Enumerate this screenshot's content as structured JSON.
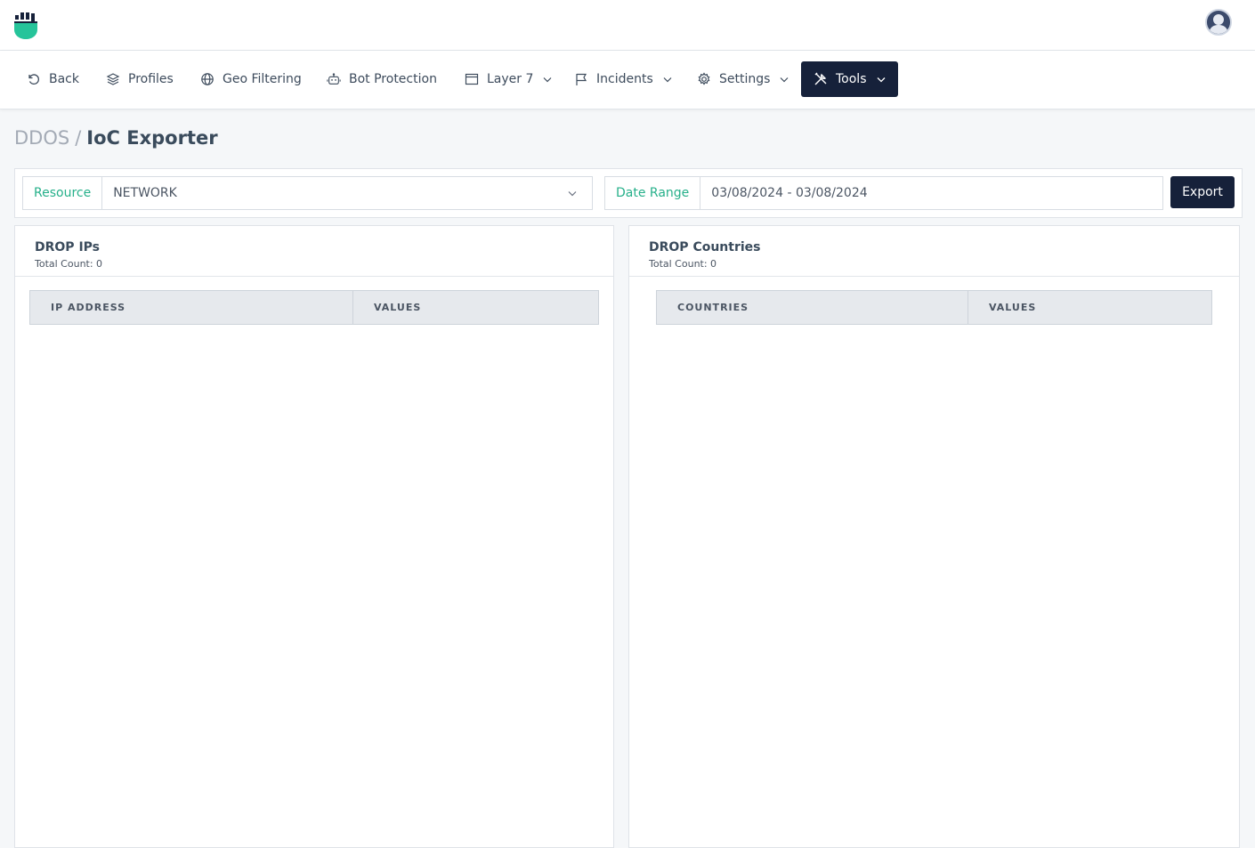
{
  "nav": {
    "back": "Back",
    "profiles": "Profiles",
    "geo_filtering": "Geo Filtering",
    "bot_protection": "Bot Protection",
    "layer7": "Layer 7",
    "incidents": "Incidents",
    "settings": "Settings",
    "tools": "Tools"
  },
  "breadcrumb": {
    "parent": "DDOS",
    "separator": "/",
    "current": "IoC Exporter"
  },
  "filters": {
    "resource_label": "Resource",
    "resource_value": "NETWORK",
    "date_label": "Date Range",
    "date_value": "03/08/2024 - 03/08/2024",
    "export_label": "Export"
  },
  "panels": {
    "drop_ips": {
      "title": "DROP IPs",
      "count": "Total Count: 0",
      "columns": [
        "IP ADDRESS",
        "VALUES"
      ]
    },
    "drop_countries": {
      "title": "DROP Countries",
      "count": "Total Count: 0",
      "columns": [
        "COUNTRIES",
        "VALUES"
      ]
    }
  },
  "colors": {
    "accent": "#26b08a",
    "primary_dark": "#16213a"
  }
}
